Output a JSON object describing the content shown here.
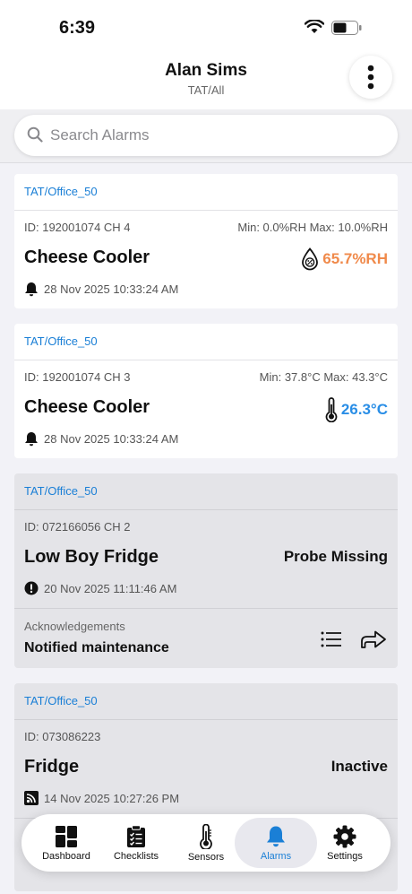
{
  "status": {
    "time": "6:39"
  },
  "header": {
    "title": "Alan Sims",
    "subtitle": "TAT/All"
  },
  "search": {
    "placeholder": "Search Alarms"
  },
  "colors": {
    "accent": "#1a7fd6",
    "warning": "#f08a4b",
    "cold": "#2a8ee6"
  },
  "alarms": [
    {
      "location": "TAT/Office_50",
      "id": "ID: 192001074 CH 4",
      "range": "Min: 0.0%RH Max: 10.0%RH",
      "name": "Cheese Cooler",
      "reading": "65.7%RH",
      "reading_icon": "humidity-icon",
      "time": "28 Nov 2025 10:33:24 AM",
      "time_icon": "bell-icon"
    },
    {
      "location": "TAT/Office_50",
      "id": "ID: 192001074 CH 3",
      "range": "Min: 37.8°C Max: 43.3°C",
      "name": "Cheese Cooler",
      "reading": "26.3°C",
      "reading_icon": "thermometer-icon",
      "time": "28 Nov 2025 10:33:24 AM",
      "time_icon": "bell-icon"
    },
    {
      "location": "TAT/Office_50",
      "id": "ID: 072166056 CH 2",
      "name": "Low Boy Fridge",
      "reading": "Probe Missing",
      "time": "20 Nov 2025 11:11:46 AM",
      "time_icon": "exclamation-icon",
      "ack_label": "Acknowledgements",
      "ack_value": "Notified maintenance"
    },
    {
      "location": "TAT/Office_50",
      "id": "ID: 073086223",
      "name": "Fridge",
      "reading": "Inactive",
      "time": "14 Nov 2025 10:27:26 PM",
      "time_icon": "signal-icon"
    }
  ],
  "tabs": [
    {
      "label": "Dashboard",
      "icon": "dashboard-icon"
    },
    {
      "label": "Checklists",
      "icon": "checklist-icon"
    },
    {
      "label": "Sensors",
      "icon": "thermometer-icon"
    },
    {
      "label": "Alarms",
      "icon": "bell-icon",
      "active": true
    },
    {
      "label": "Settings",
      "icon": "gear-icon"
    }
  ]
}
